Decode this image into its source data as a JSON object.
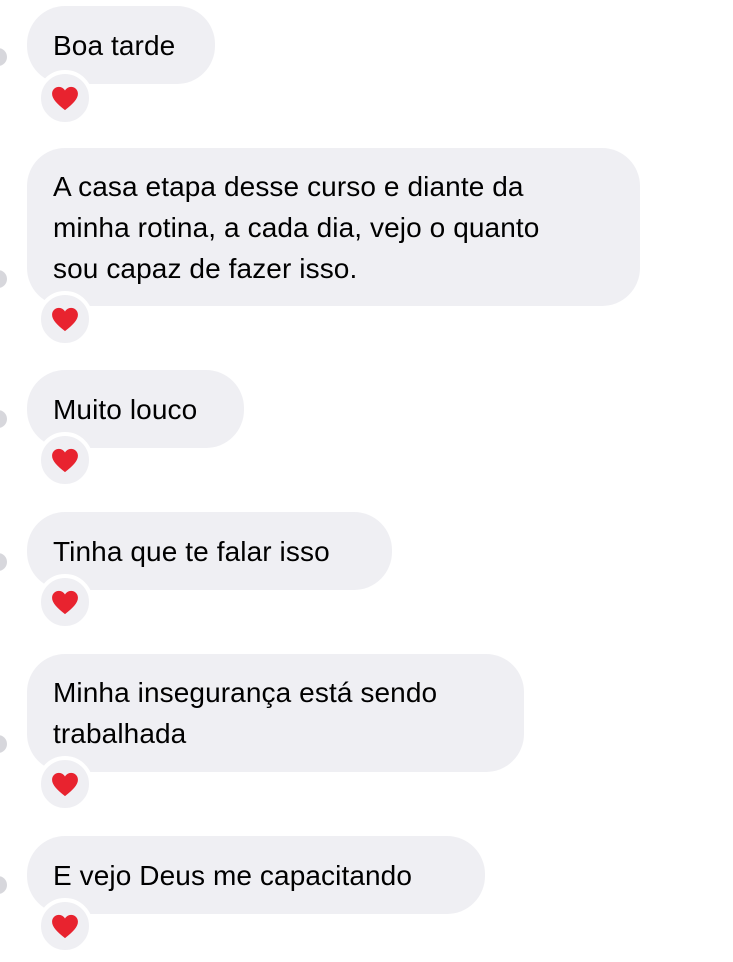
{
  "conversation": {
    "messages": [
      {
        "text": "Boa tarde",
        "reaction": "heart-icon"
      },
      {
        "text": "A casa etapa desse curso e diante da\nminha rotina, a cada dia, vejo o quanto\nsou capaz de fazer isso.",
        "reaction": "heart-icon"
      },
      {
        "text": "Muito louco",
        "reaction": "heart-icon"
      },
      {
        "text": "Tinha que te falar isso",
        "reaction": "heart-icon"
      },
      {
        "text": "Minha insegurança está sendo\ntrabalhada",
        "reaction": "heart-icon"
      },
      {
        "text": "E vejo Deus me capacitando",
        "reaction": "heart-icon"
      }
    ]
  },
  "colors": {
    "bubble": "#efeff3",
    "heart": "#e8232f",
    "background": "#ffffff"
  }
}
